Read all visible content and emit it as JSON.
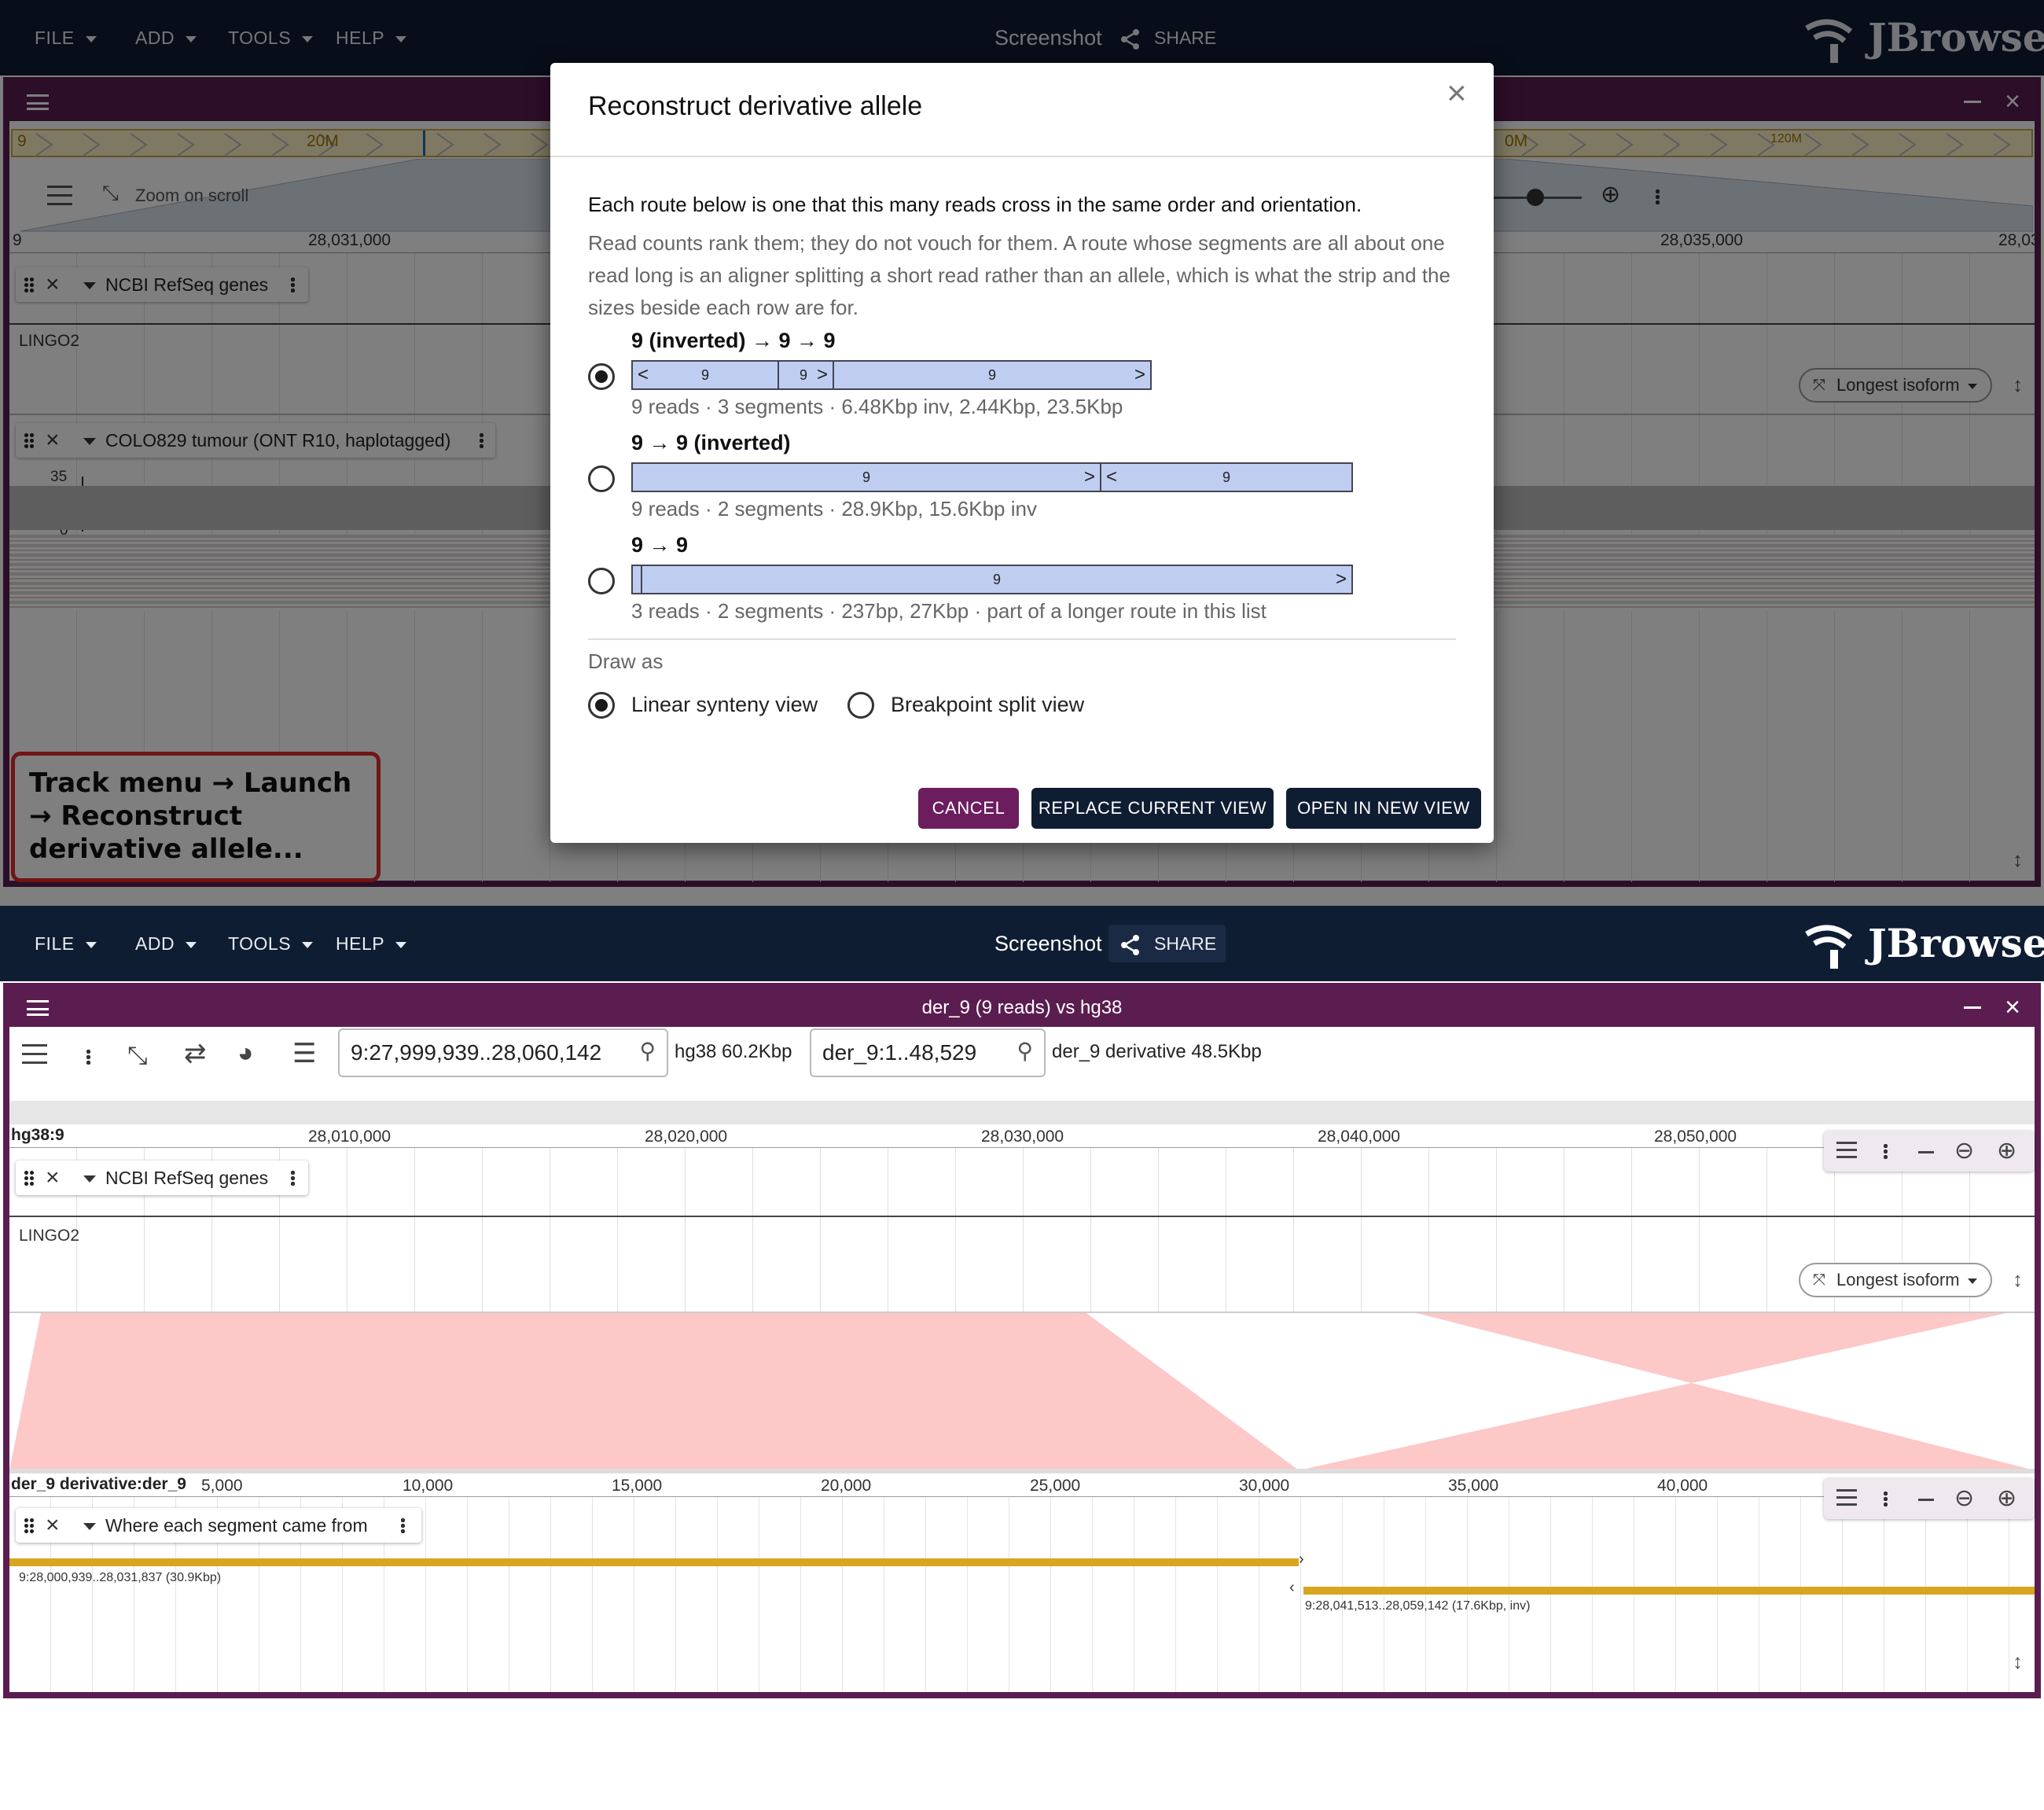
{
  "appbar": {
    "menus": [
      "FILE",
      "ADD",
      "TOOLS",
      "HELP"
    ],
    "screenshot_label": "Screenshot",
    "share_label": "SHARE",
    "brand": "JBrowse"
  },
  "top_view": {
    "overview": {
      "chrom": "9",
      "ticks": [
        "20M",
        "0M",
        "120M"
      ]
    },
    "zoom_label": "Zoom on scroll",
    "ruler": {
      "chrom": "9",
      "ticks": [
        "28,031,000",
        "28,035,000",
        "28,03"
      ]
    },
    "tracks": [
      {
        "name": "NCBI RefSeq genes",
        "feature": "LINGO2",
        "isoform": "Longest isoform"
      },
      {
        "name": "COLO829 tumour (ONT R10, haplotagged)",
        "scale_max": "35",
        "scale_min": "0"
      }
    ],
    "callout": "Track menu → Launch → Reconstruct derivative allele..."
  },
  "dialog": {
    "title": "Reconstruct derivative allele",
    "intro": "Each route below is one that this many reads cross in the same order and orientation.",
    "note": "Read counts rank them; they do not vouch for them. A route whose segments are all about one read long is an aligner splitting a short read rather than an allele, which is what the strip and the sizes beside each row are for.",
    "routes": [
      {
        "title": "9 (inverted) → 9 → 9",
        "meta": "9 reads · 3 segments · 6.48Kbp inv, 2.44Kbp, 23.5Kbp",
        "selected": true,
        "segments": [
          {
            "label": "9",
            "dir": "left"
          },
          {
            "label": "9",
            "dir": "right"
          },
          {
            "label": "9",
            "dir": "right"
          }
        ]
      },
      {
        "title": "9 → 9 (inverted)",
        "meta": "9 reads · 2 segments · 28.9Kbp, 15.6Kbp inv",
        "selected": false,
        "segments": [
          {
            "label": "9",
            "dir": "right"
          },
          {
            "label": "9",
            "dir": "left"
          }
        ]
      },
      {
        "title": "9 → 9",
        "meta": "3 reads · 2 segments · 237bp, 27Kbp · part of a longer route in this list",
        "selected": false,
        "segments": [
          {
            "label": "",
            "dir": "none"
          },
          {
            "label": "9",
            "dir": "right"
          }
        ]
      }
    ],
    "draw_as_label": "Draw as",
    "draw_options": [
      {
        "label": "Linear synteny view",
        "selected": true
      },
      {
        "label": "Breakpoint split view",
        "selected": false
      }
    ],
    "buttons": {
      "cancel": "CANCEL",
      "replace": "REPLACE CURRENT VIEW",
      "open": "OPEN IN NEW VIEW"
    },
    "colors": {
      "cancel": "#6b1d5e",
      "primary": "#0f1d33",
      "segment": "#bfcdf1"
    }
  },
  "bottom_view": {
    "title": "der_9 (9 reads) vs hg38",
    "loc1": {
      "value": "9:27,999,939..28,060,142",
      "assembly": "hg38 60.2Kbp"
    },
    "loc2": {
      "value": "der_9:1..48,529",
      "assembly": "der_9 derivative 48.5Kbp"
    },
    "ruler1": {
      "name": "hg38:9",
      "ticks": [
        "28,010,000",
        "28,020,000",
        "28,030,000",
        "28,040,000",
        "28,050,000"
      ]
    },
    "ruler2": {
      "name": "der_9 derivative:der_9",
      "ticks": [
        "5,000",
        "10,000",
        "15,000",
        "20,000",
        "25,000",
        "30,000",
        "35,000",
        "40,000"
      ]
    },
    "gene_track": {
      "name": "NCBI RefSeq genes",
      "feature": "LINGO2",
      "isoform": "Longest isoform"
    },
    "segment_track": {
      "name": "Where each segment came from",
      "seg1": "9:28,000,939..28,031,837 (30.9Kbp)",
      "seg2": "9:28,041,513..28,059,142 (17.6Kbp, inv)",
      "color": "#d9a520"
    },
    "synteny_color": "#fcc8c8"
  }
}
